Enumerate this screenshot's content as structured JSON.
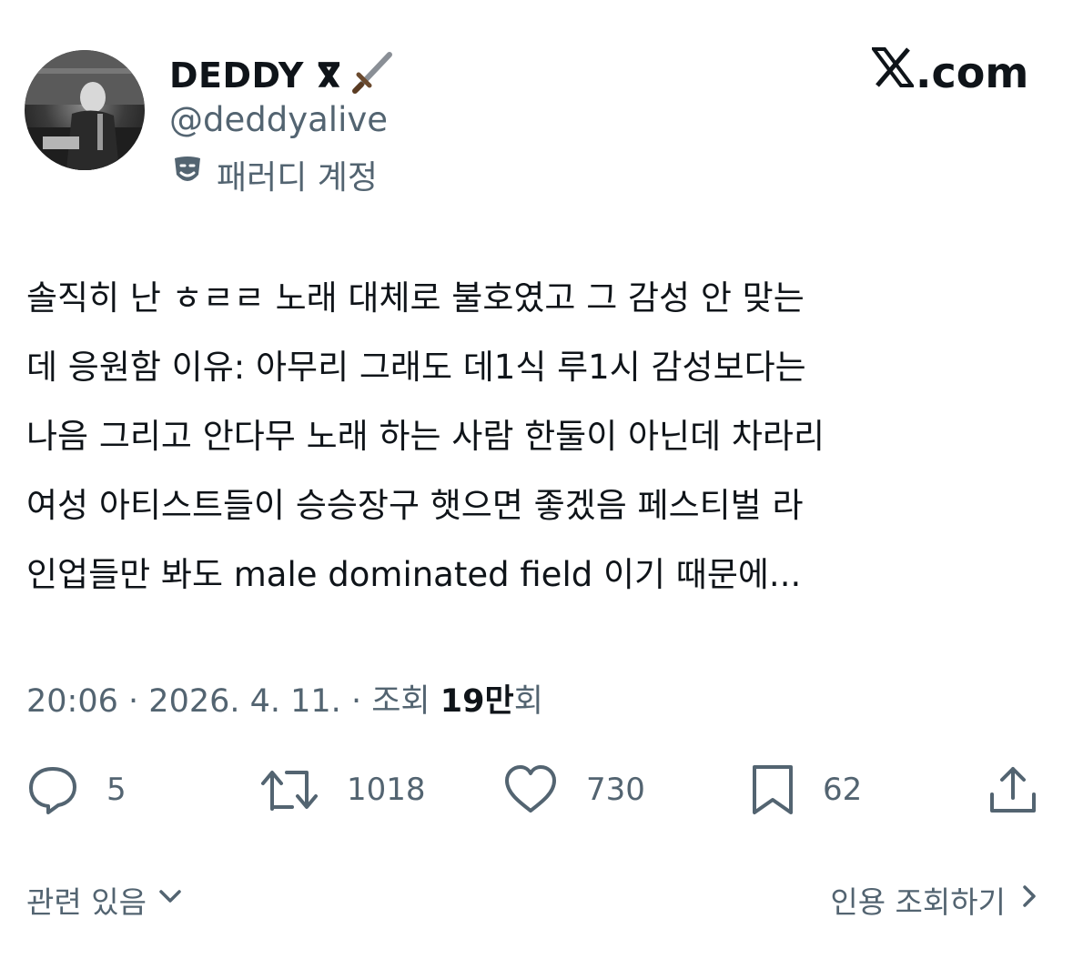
{
  "header": {
    "display_name": "DEDDY ⴳ",
    "handle": "@deddyalive",
    "parody_label": "패러디 계정",
    "site": ".com"
  },
  "tweet": {
    "text": "솔직히 난 ㅎㄹㄹ 노래 대체로 불호였고 그 감성 안 맞는\n데 응원함 이유: 아무리 그래도 데1식 루1시 감성보다는\n나음 그리고 안다무 노래 하는 사람 한둘이 아닌데 차라리\n여성 아티스트들이 승승장구 햇으면 좋겠음 페스티벌 라\n인업들만 봐도 male dominated field 이기 때문에...",
    "time": "20:06",
    "date": "2026. 4. 11.",
    "views_label": "조회",
    "views_count": "19만",
    "views_suffix": "회",
    "sep": "·"
  },
  "actions": {
    "replies": "5",
    "retweets": "1018",
    "likes": "730",
    "bookmarks": "62"
  },
  "footer": {
    "related": "관련 있음",
    "quotes": "인용 조회하기"
  },
  "icons": [
    "dagger-icon",
    "theater-mask-icon",
    "reply-icon",
    "retweet-icon",
    "heart-icon",
    "bookmark-icon",
    "share-icon",
    "chevron-down-icon",
    "chevron-right-icon"
  ]
}
